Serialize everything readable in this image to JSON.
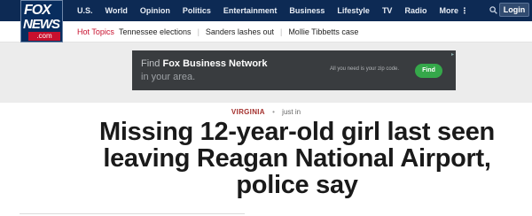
{
  "brand": {
    "logo_line1": "FOX",
    "logo_line2": "NEWS",
    "logo_line3": ".com"
  },
  "nav": {
    "items": [
      "U.S.",
      "World",
      "Opinion",
      "Politics",
      "Entertainment",
      "Business",
      "Lifestyle",
      "TV",
      "Radio",
      "More ⋮"
    ],
    "login_label": "Login"
  },
  "hot_topics": {
    "label": "Hot Topics",
    "items": [
      "Tennessee elections",
      "Sanders lashes out",
      "Mollie Tibbetts case"
    ]
  },
  "ad": {
    "find_text": "Find",
    "brand_text": "Fox Business Network",
    "line2": "in your area.",
    "note": "All you need is your zip code.",
    "button_label": "Find"
  },
  "article": {
    "category": "VIRGINIA",
    "separator": "•",
    "timestamp": "just in",
    "headline": "Missing 12-year-old girl last seen leaving Reagan National Airport, police say"
  },
  "colors": {
    "topbar": "#0d2a54",
    "hot_topic_red": "#c8102e",
    "ad_button_green": "#35a84a",
    "category_red": "#a4312e"
  }
}
